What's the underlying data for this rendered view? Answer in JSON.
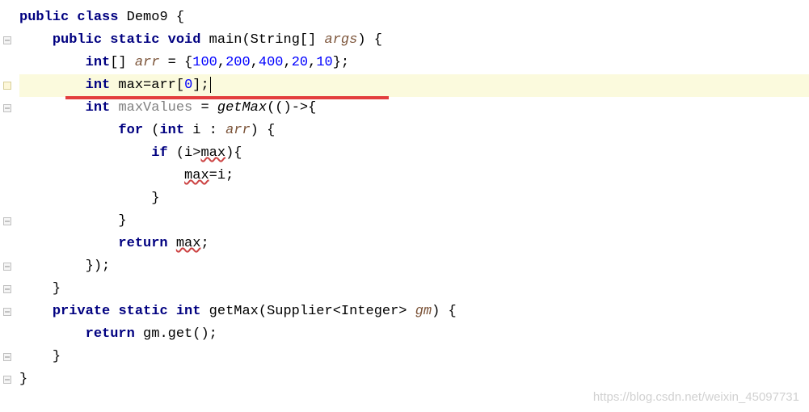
{
  "code": {
    "l1_public": "public",
    "l1_class": "class",
    "l1_name": "Demo9",
    "l1_brace": " {",
    "l2_public": "public",
    "l2_static": "static",
    "l2_void": "void",
    "l2_main": "main",
    "l2_params_open": "(String[] ",
    "l2_args": "args",
    "l2_params_close": ") {",
    "l3_int": "int",
    "l3_arr": "arr",
    "l3_eq": " = {",
    "l3_n1": "100",
    "l3_c1": ",",
    "l3_n2": "200",
    "l3_c2": ",",
    "l3_n3": "400",
    "l3_c3": ",",
    "l3_n4": "20",
    "l3_c4": ",",
    "l3_n5": "10",
    "l3_close": "};",
    "l4_int": "int",
    "l4_rest": " max=arr[",
    "l4_zero": "0",
    "l4_end": "];",
    "l5_int": "int",
    "l5_var": "maxValues",
    "l5_eq": " = ",
    "l5_getmax": "getMax",
    "l5_rest": "(()->{",
    "l6_for": "for",
    "l6_open": " (",
    "l6_int": "int",
    "l6_i": " i : ",
    "l6_arr": "arr",
    "l6_close": ") {",
    "l7_if": "if",
    "l7_open": " (i>",
    "l7_max": "max",
    "l7_close": "){",
    "l8_max": "max",
    "l8_rest": "=i;",
    "l9_brace": "}",
    "l10_brace": "}",
    "l11_return": "return",
    "l11_sp": " ",
    "l11_max": "max",
    "l11_semi": ";",
    "l12_close": "});",
    "l13_brace": "}",
    "l14_private": "private",
    "l14_static": "static",
    "l14_int": "int",
    "l14_getmax": " getMax(Supplier<Integer> ",
    "l14_gm": "gm",
    "l14_close": ") {",
    "l15_return": "return",
    "l15_rest": " gm.get();",
    "l16_brace": "}",
    "l17_brace": "}"
  },
  "watermark": "https://blog.csdn.net/weixin_45097731",
  "indent": {
    "i0": "",
    "i1": "    ",
    "i2": "        ",
    "i3": "            ",
    "i4": "                ",
    "i5": "                    "
  }
}
